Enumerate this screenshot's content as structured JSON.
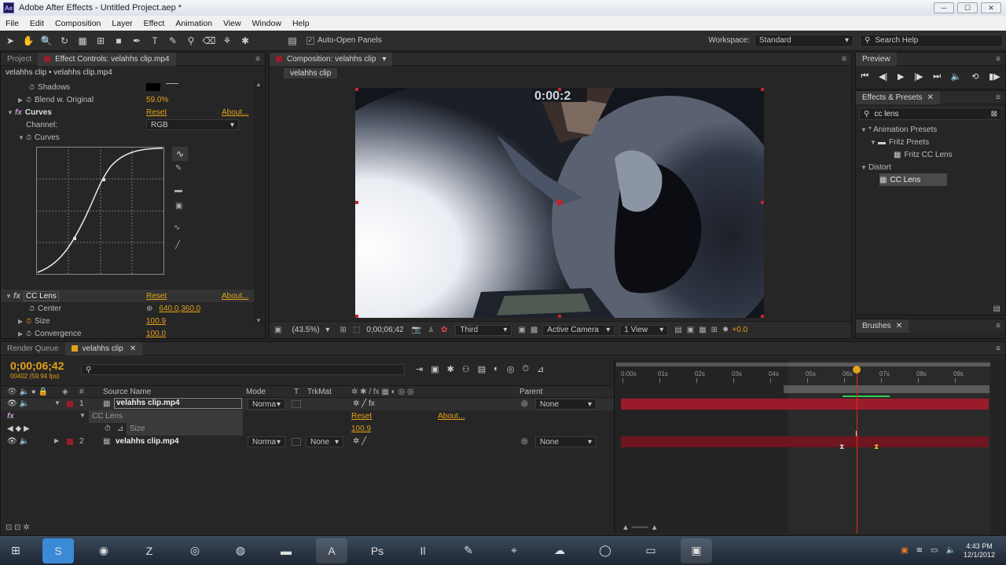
{
  "window": {
    "title": "Adobe After Effects - Untitled Project.aep *",
    "logo": "Ae",
    "min": "─",
    "max": "☐",
    "close": "✕"
  },
  "menu": [
    "File",
    "Edit",
    "Composition",
    "Layer",
    "Effect",
    "Animation",
    "View",
    "Window",
    "Help"
  ],
  "toolbar": {
    "auto_open": "Auto-Open Panels",
    "workspace_label": "Workspace:",
    "workspace_value": "Standard",
    "search_placeholder": "Search Help"
  },
  "effect_panel": {
    "tab_project": "Project",
    "tab_effect": "Effect Controls: velahhs clip.mp4",
    "breadcrumb": "velahhs clip • velahhs clip.mp4",
    "shadows_label": "Shadows",
    "blend_label": "Blend w. Original",
    "blend_value": "59.0%",
    "curves_label": "Curves",
    "reset": "Reset",
    "about": "About...",
    "channel_label": "Channel:",
    "channel_value": "RGB",
    "curves_sub": "Curves",
    "cclens_label": "CC Lens",
    "center_label": "Center",
    "center_value": "640.0,360.0",
    "size_label": "Size",
    "size_value": "100.9",
    "convergence_label": "Convergence",
    "convergence_value": "100.0"
  },
  "comp_panel": {
    "tab": "Composition: velahhs clip",
    "subtab": "velahhs clip",
    "overlay_text": "0:00:2",
    "zoom": "(43.5%)",
    "timecode": "0;00;06;42",
    "resolution": "Third",
    "camera": "Active Camera",
    "views": "1 View",
    "exposure": "+0.0"
  },
  "preview_panel": {
    "title": "Preview"
  },
  "effects_presets": {
    "title": "Effects & Presets",
    "search_value": "cc lens",
    "tree": [
      {
        "label": "* Animation Presets",
        "level": 0
      },
      {
        "label": "Fritz Preets",
        "level": 1
      },
      {
        "label": "Fritz CC Lens",
        "level": 2
      },
      {
        "label": "Distort",
        "level": 0
      },
      {
        "label": "CC Lens",
        "level": 1
      }
    ]
  },
  "brushes": {
    "title": "Brushes"
  },
  "timeline": {
    "tab_render": "Render Queue",
    "tab_comp": "velahhs clip",
    "timecode": "0;00;06;42",
    "frame_info": "00402 (59.94 fps)",
    "col_source": "Source Name",
    "col_mode": "Mode",
    "col_t": "T",
    "col_trkmat": "TrkMat",
    "col_parent": "Parent",
    "ruler": [
      "0:00s",
      "01s",
      "02s",
      "03s",
      "04s",
      "05s",
      "06s",
      "07s",
      "08s",
      "09s",
      "1"
    ],
    "layers": [
      {
        "num": "1",
        "name": "velahhs clip.mp4",
        "mode": "Norma",
        "trkmat": "",
        "parent": "None"
      },
      {
        "num": "2",
        "name": "velahhs clip.mp4",
        "mode": "Norma",
        "trkmat": "None",
        "parent": "None"
      }
    ],
    "effect_row": {
      "name": "CC Lens",
      "reset": "Reset",
      "about": "About..."
    },
    "size_row": {
      "name": "Size",
      "value": "100.9"
    },
    "playhead_fraction": 0.645
  },
  "taskbar": {
    "clock_time": "4:43 PM",
    "clock_date": "12/1/2012"
  }
}
